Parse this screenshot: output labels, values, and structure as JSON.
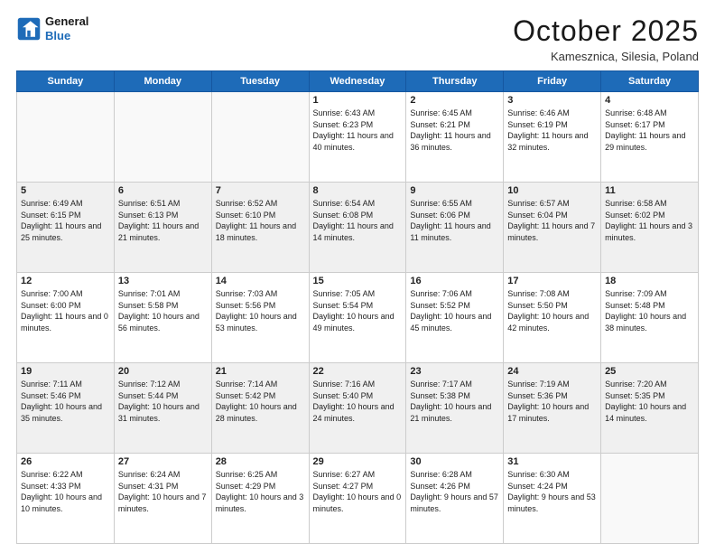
{
  "header": {
    "logo_general": "General",
    "logo_blue": "Blue",
    "month_title": "October 2025",
    "location": "Kamesznica, Silesia, Poland"
  },
  "days_of_week": [
    "Sunday",
    "Monday",
    "Tuesday",
    "Wednesday",
    "Thursday",
    "Friday",
    "Saturday"
  ],
  "weeks": [
    [
      {
        "day": "",
        "sunrise": "",
        "sunset": "",
        "daylight": ""
      },
      {
        "day": "",
        "sunrise": "",
        "sunset": "",
        "daylight": ""
      },
      {
        "day": "",
        "sunrise": "",
        "sunset": "",
        "daylight": ""
      },
      {
        "day": "1",
        "sunrise": "Sunrise: 6:43 AM",
        "sunset": "Sunset: 6:23 PM",
        "daylight": "Daylight: 11 hours and 40 minutes."
      },
      {
        "day": "2",
        "sunrise": "Sunrise: 6:45 AM",
        "sunset": "Sunset: 6:21 PM",
        "daylight": "Daylight: 11 hours and 36 minutes."
      },
      {
        "day": "3",
        "sunrise": "Sunrise: 6:46 AM",
        "sunset": "Sunset: 6:19 PM",
        "daylight": "Daylight: 11 hours and 32 minutes."
      },
      {
        "day": "4",
        "sunrise": "Sunrise: 6:48 AM",
        "sunset": "Sunset: 6:17 PM",
        "daylight": "Daylight: 11 hours and 29 minutes."
      }
    ],
    [
      {
        "day": "5",
        "sunrise": "Sunrise: 6:49 AM",
        "sunset": "Sunset: 6:15 PM",
        "daylight": "Daylight: 11 hours and 25 minutes."
      },
      {
        "day": "6",
        "sunrise": "Sunrise: 6:51 AM",
        "sunset": "Sunset: 6:13 PM",
        "daylight": "Daylight: 11 hours and 21 minutes."
      },
      {
        "day": "7",
        "sunrise": "Sunrise: 6:52 AM",
        "sunset": "Sunset: 6:10 PM",
        "daylight": "Daylight: 11 hours and 18 minutes."
      },
      {
        "day": "8",
        "sunrise": "Sunrise: 6:54 AM",
        "sunset": "Sunset: 6:08 PM",
        "daylight": "Daylight: 11 hours and 14 minutes."
      },
      {
        "day": "9",
        "sunrise": "Sunrise: 6:55 AM",
        "sunset": "Sunset: 6:06 PM",
        "daylight": "Daylight: 11 hours and 11 minutes."
      },
      {
        "day": "10",
        "sunrise": "Sunrise: 6:57 AM",
        "sunset": "Sunset: 6:04 PM",
        "daylight": "Daylight: 11 hours and 7 minutes."
      },
      {
        "day": "11",
        "sunrise": "Sunrise: 6:58 AM",
        "sunset": "Sunset: 6:02 PM",
        "daylight": "Daylight: 11 hours and 3 minutes."
      }
    ],
    [
      {
        "day": "12",
        "sunrise": "Sunrise: 7:00 AM",
        "sunset": "Sunset: 6:00 PM",
        "daylight": "Daylight: 11 hours and 0 minutes."
      },
      {
        "day": "13",
        "sunrise": "Sunrise: 7:01 AM",
        "sunset": "Sunset: 5:58 PM",
        "daylight": "Daylight: 10 hours and 56 minutes."
      },
      {
        "day": "14",
        "sunrise": "Sunrise: 7:03 AM",
        "sunset": "Sunset: 5:56 PM",
        "daylight": "Daylight: 10 hours and 53 minutes."
      },
      {
        "day": "15",
        "sunrise": "Sunrise: 7:05 AM",
        "sunset": "Sunset: 5:54 PM",
        "daylight": "Daylight: 10 hours and 49 minutes."
      },
      {
        "day": "16",
        "sunrise": "Sunrise: 7:06 AM",
        "sunset": "Sunset: 5:52 PM",
        "daylight": "Daylight: 10 hours and 45 minutes."
      },
      {
        "day": "17",
        "sunrise": "Sunrise: 7:08 AM",
        "sunset": "Sunset: 5:50 PM",
        "daylight": "Daylight: 10 hours and 42 minutes."
      },
      {
        "day": "18",
        "sunrise": "Sunrise: 7:09 AM",
        "sunset": "Sunset: 5:48 PM",
        "daylight": "Daylight: 10 hours and 38 minutes."
      }
    ],
    [
      {
        "day": "19",
        "sunrise": "Sunrise: 7:11 AM",
        "sunset": "Sunset: 5:46 PM",
        "daylight": "Daylight: 10 hours and 35 minutes."
      },
      {
        "day": "20",
        "sunrise": "Sunrise: 7:12 AM",
        "sunset": "Sunset: 5:44 PM",
        "daylight": "Daylight: 10 hours and 31 minutes."
      },
      {
        "day": "21",
        "sunrise": "Sunrise: 7:14 AM",
        "sunset": "Sunset: 5:42 PM",
        "daylight": "Daylight: 10 hours and 28 minutes."
      },
      {
        "day": "22",
        "sunrise": "Sunrise: 7:16 AM",
        "sunset": "Sunset: 5:40 PM",
        "daylight": "Daylight: 10 hours and 24 minutes."
      },
      {
        "day": "23",
        "sunrise": "Sunrise: 7:17 AM",
        "sunset": "Sunset: 5:38 PM",
        "daylight": "Daylight: 10 hours and 21 minutes."
      },
      {
        "day": "24",
        "sunrise": "Sunrise: 7:19 AM",
        "sunset": "Sunset: 5:36 PM",
        "daylight": "Daylight: 10 hours and 17 minutes."
      },
      {
        "day": "25",
        "sunrise": "Sunrise: 7:20 AM",
        "sunset": "Sunset: 5:35 PM",
        "daylight": "Daylight: 10 hours and 14 minutes."
      }
    ],
    [
      {
        "day": "26",
        "sunrise": "Sunrise: 6:22 AM",
        "sunset": "Sunset: 4:33 PM",
        "daylight": "Daylight: 10 hours and 10 minutes."
      },
      {
        "day": "27",
        "sunrise": "Sunrise: 6:24 AM",
        "sunset": "Sunset: 4:31 PM",
        "daylight": "Daylight: 10 hours and 7 minutes."
      },
      {
        "day": "28",
        "sunrise": "Sunrise: 6:25 AM",
        "sunset": "Sunset: 4:29 PM",
        "daylight": "Daylight: 10 hours and 3 minutes."
      },
      {
        "day": "29",
        "sunrise": "Sunrise: 6:27 AM",
        "sunset": "Sunset: 4:27 PM",
        "daylight": "Daylight: 10 hours and 0 minutes."
      },
      {
        "day": "30",
        "sunrise": "Sunrise: 6:28 AM",
        "sunset": "Sunset: 4:26 PM",
        "daylight": "Daylight: 9 hours and 57 minutes."
      },
      {
        "day": "31",
        "sunrise": "Sunrise: 6:30 AM",
        "sunset": "Sunset: 4:24 PM",
        "daylight": "Daylight: 9 hours and 53 minutes."
      },
      {
        "day": "",
        "sunrise": "",
        "sunset": "",
        "daylight": ""
      }
    ]
  ]
}
